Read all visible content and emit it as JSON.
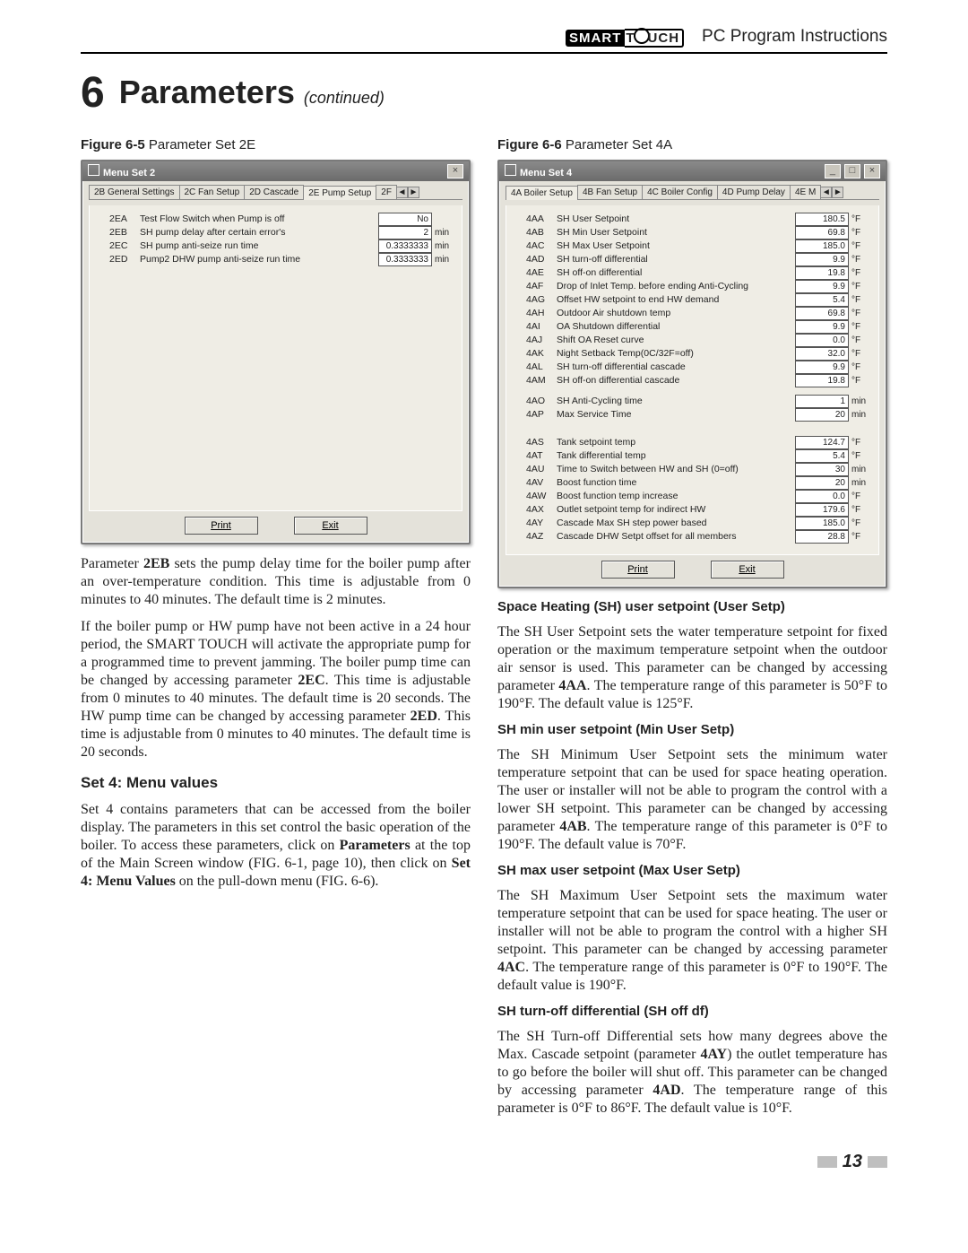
{
  "header": {
    "logo_left": "SMART",
    "logo_right": "T  UCH",
    "page_title": "PC Program Instructions"
  },
  "section": {
    "number": "6",
    "title": "Parameters",
    "continued": "(continued)"
  },
  "figure5": {
    "caption_bold": "Figure 6-5",
    "caption_rest": " Parameter Set 2E",
    "window_title": "Menu Set 2",
    "tabs": [
      "2B  General Settings",
      "2C  Fan Setup",
      "2D  Cascade",
      "2E  Pump Setup",
      "2F"
    ],
    "active_tab": 3,
    "params": [
      {
        "code": "2EA",
        "label": "Test Flow Switch when Pump is off",
        "val": "No",
        "unit": ""
      },
      {
        "code": "2EB",
        "label": "SH pump delay after certain error's",
        "val": "2",
        "unit": "min"
      },
      {
        "code": "2EC",
        "label": "SH pump anti-seize run time",
        "val": "0.3333333",
        "unit": "min"
      },
      {
        "code": "2ED",
        "label": "Pump2 DHW pump anti-seize run time",
        "val": "0.3333333",
        "unit": "min"
      }
    ],
    "btn_print": "Print",
    "btn_exit": "Exit"
  },
  "figure6": {
    "caption_bold": "Figure 6-6",
    "caption_rest": " Parameter Set 4A",
    "window_title": "Menu Set 4",
    "tabs": [
      "4A  Boiler Setup",
      "4B  Fan Setup",
      "4C  Boiler Config",
      "4D  Pump Delay",
      "4E  M"
    ],
    "active_tab": 0,
    "params1": [
      {
        "code": "4AA",
        "label": "SH User Setpoint",
        "val": "180.5",
        "unit": "°F"
      },
      {
        "code": "4AB",
        "label": "SH Min User Setpoint",
        "val": "69.8",
        "unit": "°F"
      },
      {
        "code": "4AC",
        "label": "SH Max User Setpoint",
        "val": "185.0",
        "unit": "°F"
      },
      {
        "code": "4AD",
        "label": "SH turn-off differential",
        "val": "9.9",
        "unit": "°F"
      },
      {
        "code": "4AE",
        "label": "SH off-on differential",
        "val": "19.8",
        "unit": "°F"
      },
      {
        "code": "4AF",
        "label": "Drop of Inlet Temp. before ending Anti-Cycling",
        "val": "9.9",
        "unit": "°F"
      },
      {
        "code": "4AG",
        "label": "Offset HW setpoint to end HW demand",
        "val": "5.4",
        "unit": "°F"
      },
      {
        "code": "4AH",
        "label": "Outdoor Air shutdown temp",
        "val": "69.8",
        "unit": "°F"
      },
      {
        "code": "4AI",
        "label": "OA Shutdown differential",
        "val": "9.9",
        "unit": "°F"
      },
      {
        "code": "4AJ",
        "label": "Shift OA Reset curve",
        "val": "0.0",
        "unit": "°F"
      },
      {
        "code": "4AK",
        "label": "Night Setback Temp(0C/32F=off)",
        "val": "32.0",
        "unit": "°F"
      },
      {
        "code": "4AL",
        "label": "SH turn-off differential cascade",
        "val": "9.9",
        "unit": "°F"
      },
      {
        "code": "4AM",
        "label": "SH off-on differential cascade",
        "val": "19.8",
        "unit": "°F"
      }
    ],
    "params2": [
      {
        "code": "4AO",
        "label": "SH Anti-Cycling time",
        "val": "1",
        "unit": "min"
      },
      {
        "code": "4AP",
        "label": "Max Service Time",
        "val": "20",
        "unit": "min"
      }
    ],
    "params3": [
      {
        "code": "4AS",
        "label": "Tank setpoint temp",
        "val": "124.7",
        "unit": "°F"
      },
      {
        "code": "4AT",
        "label": "Tank differential temp",
        "val": "5.4",
        "unit": "°F"
      },
      {
        "code": "4AU",
        "label": "Time to Switch between HW and SH (0=off)",
        "val": "30",
        "unit": "min"
      },
      {
        "code": "4AV",
        "label": "Boost function time",
        "val": "20",
        "unit": "min"
      },
      {
        "code": "4AW",
        "label": "Boost function temp increase",
        "val": "0.0",
        "unit": "°F"
      },
      {
        "code": "4AX",
        "label": "Outlet setpoint temp for indirect HW",
        "val": "179.6",
        "unit": "°F"
      },
      {
        "code": "4AY",
        "label": "Cascade Max SH step power based",
        "val": "185.0",
        "unit": "°F"
      },
      {
        "code": "4AZ",
        "label": "Cascade DHW Setpt offset for all members",
        "val": "28.8",
        "unit": "°F"
      }
    ],
    "btn_print": "Print",
    "btn_exit": "Exit"
  },
  "left_text": {
    "p1": "Parameter 2EB sets the pump delay time for the boiler pump after an over-temperature condition. This time is adjustable from 0 minutes to 40 minutes. The default time is 2 minutes.",
    "p2": "If the boiler pump or HW pump have not been active in a 24 hour period, the SMART TOUCH will activate the appropriate pump for a programmed time to prevent jamming.  The boiler pump time can be changed by accessing parameter 2EC. This time is adjustable from 0 minutes to 40 minutes. The default time is 20 seconds.  The HW pump time can be changed by accessing parameter 2ED. This time is adjustable from 0 minutes to 40 minutes. The default time is 20 seconds.",
    "h_set4": "Set 4: Menu values",
    "p3": "Set 4 contains parameters that can be accessed from the boiler display. The parameters in this set control the basic operation of the boiler.  To access these parameters, click on Parameters at the top of the Main Screen window (FIG. 6-1, page 10), then click on Set 4: Menu Values on the pull-down menu (FIG. 6-6)."
  },
  "right_text": {
    "h1": "Space Heating (SH) user setpoint (User Setp)",
    "p1": "The SH User Setpoint sets the water temperature setpoint for fixed operation or the maximum temperature setpoint when the outdoor air sensor is used. This parameter can be changed by accessing parameter 4AA. The temperature range of this parameter is 50°F to 190°F. The default value is 125°F.",
    "h2": "SH min user setpoint (Min User Setp)",
    "p2": "The SH Minimum User Setpoint sets the minimum water temperature setpoint that can be used for space heating operation. The user or installer will not be able to program the control with a lower SH setpoint. This parameter can be changed by accessing parameter 4AB. The temperature range of this parameter is 0°F to 190°F. The default value is 70°F.",
    "h3": "SH max user setpoint (Max User Setp)",
    "p3": "The SH Maximum User Setpoint sets the maximum water temperature setpoint that can be used for space heating. The user or installer will not be able to program the control with a higher SH setpoint. This parameter can be changed by accessing parameter 4AC. The temperature range of this parameter is 0°F to 190°F. The default value is 190°F.",
    "h4": "SH turn-off differential (SH off df)",
    "p4": "The SH Turn-off Differential sets how many degrees above the Max. Cascade setpoint (parameter 4AY) the outlet temperature has to go before the boiler will shut off. This parameter can be changed by accessing parameter 4AD. The temperature range of this parameter is 0°F to 86°F. The default value is 10°F."
  },
  "page_number": "13"
}
